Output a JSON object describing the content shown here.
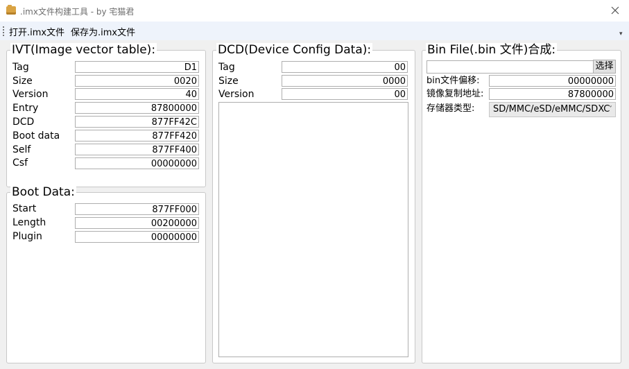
{
  "window": {
    "title": ".imx文件构建工具 - by 宅猫君"
  },
  "menu": {
    "open_label": "打开.imx文件",
    "save_label": "保存为.imx文件"
  },
  "ivt": {
    "legend": "IVT(Image vector table):",
    "rows": [
      {
        "label": "Tag",
        "value": "D1"
      },
      {
        "label": "Size",
        "value": "0020"
      },
      {
        "label": "Version",
        "value": "40"
      },
      {
        "label": "Entry",
        "value": "87800000"
      },
      {
        "label": "DCD",
        "value": "877FF42C"
      },
      {
        "label": "Boot data",
        "value": "877FF420"
      },
      {
        "label": "Self",
        "value": "877FF400"
      },
      {
        "label": "Csf",
        "value": "00000000"
      }
    ]
  },
  "boot_data": {
    "legend": "Boot Data:",
    "rows": [
      {
        "label": "Start",
        "value": "877FF000"
      },
      {
        "label": "Length",
        "value": "00200000"
      },
      {
        "label": "Plugin",
        "value": "00000000"
      }
    ]
  },
  "dcd": {
    "legend": "DCD(Device Config Data):",
    "rows": [
      {
        "label": "Tag",
        "value": "00"
      },
      {
        "label": "Size",
        "value": "0000"
      },
      {
        "label": "Version",
        "value": "00"
      }
    ],
    "data_text": ""
  },
  "bin": {
    "legend": "Bin File(.bin 文件)合成:",
    "path_value": "",
    "choose_label": "选择",
    "offset_label": "bin文件偏移:",
    "offset_value": "00000000",
    "copy_addr_label": "镜像复制地址:",
    "copy_addr_value": "87800000",
    "storage_label": "存储器类型:",
    "storage_selected": "SD/MMC/eSD/eMMC/SDXC"
  }
}
